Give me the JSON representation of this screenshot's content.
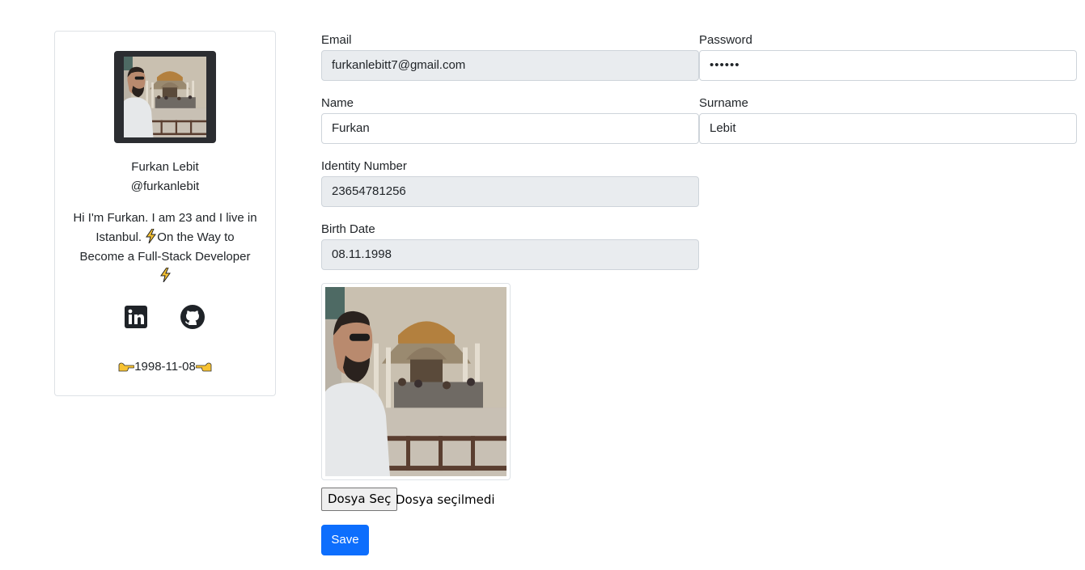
{
  "profile": {
    "name": "Furkan Lebit",
    "handle": "@furkanlebit",
    "bio_part1": "Hi I'm Furkan. I am 23 and I live in Istanbul.",
    "bio_part2": "On the Way to Become a Full-Stack Developer",
    "birth_date": "1998-11-08",
    "avatar_icon": "profile-photo",
    "social_icons": [
      "linkedin-icon",
      "github-icon"
    ]
  },
  "form": {
    "email": {
      "label": "Email",
      "value": "furkanlebitt7@gmail.com"
    },
    "password": {
      "label": "Password",
      "value": "••••••"
    },
    "name": {
      "label": "Name",
      "value": "Furkan"
    },
    "surname": {
      "label": "Surname",
      "value": "Lebit"
    },
    "identity": {
      "label": "Identity Number",
      "value": "23654781256"
    },
    "birth": {
      "label": "Birth Date",
      "value": "08.11.1998"
    },
    "file_button": "Dosya Seç",
    "file_status": "Dosya seçilmedi",
    "save_label": "Save"
  },
  "colors": {
    "primary": "#0d6efd",
    "disabled_bg": "#e9ecef",
    "border": "#ced4da"
  }
}
